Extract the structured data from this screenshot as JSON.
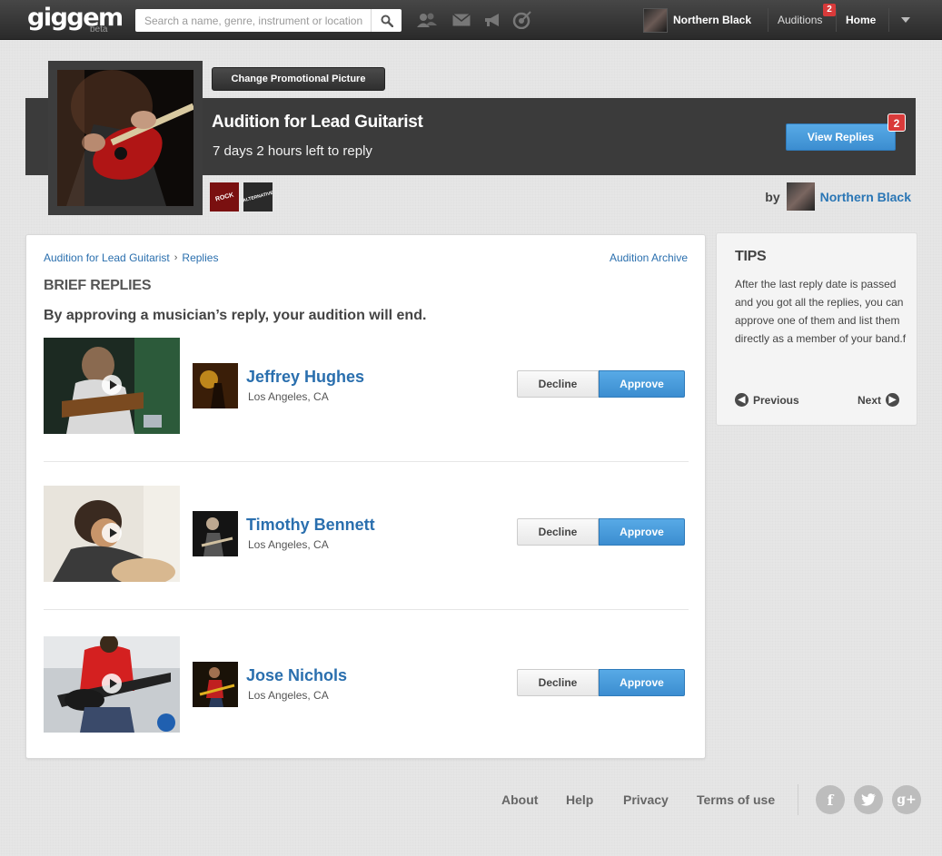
{
  "topbar": {
    "logo": "giggem",
    "logo_beta": "beta",
    "search_placeholder": "Search a name, genre, instrument or location",
    "nav_icons": [
      "people-icon",
      "mail-icon",
      "megaphone-icon",
      "target-icon"
    ],
    "user_name": "Northern Black",
    "auditions_label": "Auditions",
    "auditions_badge": "2",
    "home_label": "Home"
  },
  "audition": {
    "change_picture_label": "Change Promotional Picture",
    "title": "Audition for Lead Guitarist",
    "time_left": "7 days 2 hours left to reply",
    "view_replies_label": "View Replies",
    "replies_badge": "2",
    "genres": [
      "ROCK",
      "ALTERNATIVE"
    ],
    "by_label": "by",
    "band_name": "Northern Black"
  },
  "main": {
    "breadcrumb": [
      "Audition for Lead Guitarist",
      "Replies"
    ],
    "archive_link": "Audition Archive",
    "section_title": "BRIEF REPLIES",
    "section_subtitle": "By approving a musician’s reply, your audition will end.",
    "decline_label": "Decline",
    "approve_label": "Approve",
    "replies": [
      {
        "name": "Jeffrey Hughes",
        "location": "Los Angeles, CA"
      },
      {
        "name": "Timothy Bennett",
        "location": "Los Angeles, CA"
      },
      {
        "name": "Jose Nichols",
        "location": "Los Angeles, CA"
      }
    ]
  },
  "tips": {
    "title": "TIPS",
    "body": "After the last reply date is passed and you got all the replies, you can approve one of them and list them directly as a member of your band.f",
    "previous_label": "Previous",
    "next_label": "Next"
  },
  "footer": {
    "links": [
      "About",
      "Help",
      "Privacy",
      "Terms of use"
    ],
    "social": [
      "f",
      "t",
      "g+"
    ]
  },
  "colors": {
    "accent_blue": "#3c8dd0",
    "link_blue": "#2a6fae",
    "badge_red": "#d93a3a",
    "topbar_dark": "#2a2a2a"
  }
}
